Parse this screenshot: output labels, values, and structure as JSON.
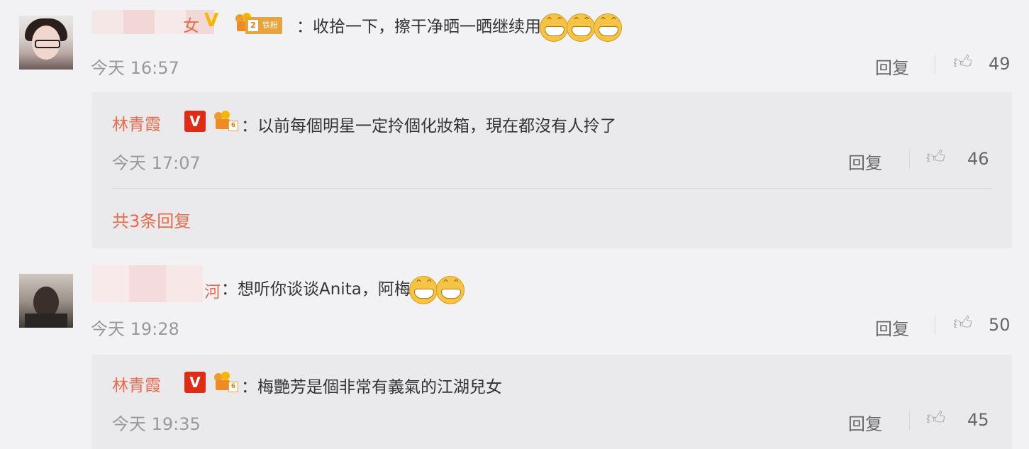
{
  "comments": [
    {
      "name_tail": "女",
      "badge_fan": "铁粉",
      "badge_fan_level": "2",
      "text": "：收拾一下，擦干净晒一晒继续用",
      "time": "今天 16:57",
      "reply_label": "回复",
      "likes": "49",
      "emoji_count": 3
    },
    {
      "name_tail": "河",
      "text": "：想听你谈谈Anita，阿梅",
      "time": "今天 19:28",
      "reply_label": "回复",
      "likes": "50",
      "emoji_count": 2
    }
  ],
  "replies": [
    {
      "name": "林青霞",
      "badge_v": "V",
      "level": "6",
      "text": "：以前每個明星一定拎個化妝箱，現在都沒有人拎了",
      "time": "今天 17:07",
      "reply_label": "回复",
      "likes": "46"
    },
    {
      "name": "林青霞",
      "badge_v": "V",
      "level": "6",
      "text": "：梅艷芳是個非常有義氣的江湖兒女",
      "time": "今天 19:35",
      "reply_label": "回复",
      "likes": "45"
    }
  ],
  "more_replies": "共3条回复",
  "icons": {
    "thumb": "thumbs-up-icon",
    "verified_gold": "gold-v-icon",
    "verified_red": "red-v-icon",
    "level": "level-badge-icon",
    "emoji": "grin-emoji-icon"
  },
  "colors": {
    "name": "#e86b4b",
    "gold_v": "#f7b500",
    "red_v": "#e02b16"
  }
}
